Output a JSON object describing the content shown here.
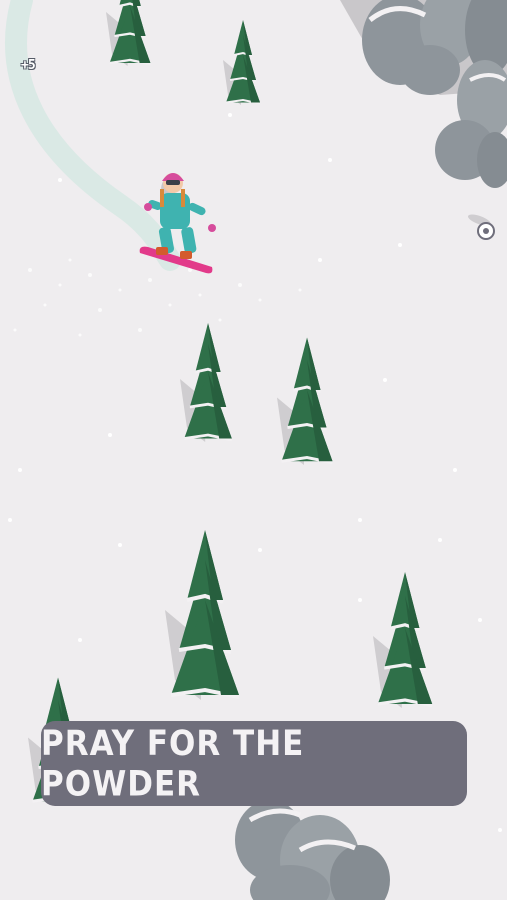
{
  "game": {
    "trick_score": "+5",
    "tagline": "PRAY FOR THE POWDER"
  },
  "palette": {
    "snow": "#efedef",
    "tree_green": "#2e6e4a",
    "tree_shadow": "#c9c7ca",
    "rock": "#8e959b",
    "banner": "#6f6e7b",
    "board": "#e23a8a",
    "jacket": "#3fb3b0"
  },
  "icons": {
    "snowboarder": "snowboarder-icon",
    "coin": "coin-icon",
    "tree": "pine-tree-icon",
    "rock": "rock-icon"
  }
}
